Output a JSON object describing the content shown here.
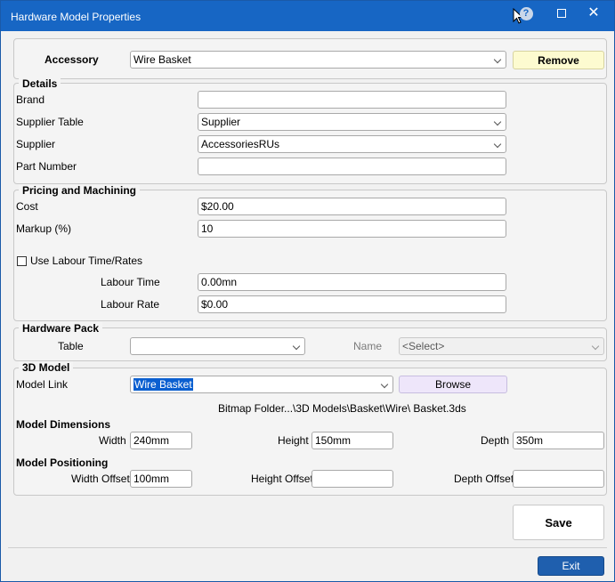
{
  "window": {
    "title": "Hardware Model Properties"
  },
  "accessory": {
    "label": "Accessory",
    "value": "Wire Basket",
    "remove_label": "Remove"
  },
  "details": {
    "title": "Details",
    "brand_label": "Brand",
    "brand_value": "",
    "supplier_table_label": "Supplier Table",
    "supplier_table_value": "Supplier",
    "supplier_label": "Supplier",
    "supplier_value": "AccessoriesRUs",
    "part_number_label": "Part Number",
    "part_number_value": ""
  },
  "pricing": {
    "title": "Pricing and Machining",
    "cost_label": "Cost",
    "cost_value": "$20.00",
    "markup_label": "Markup (%)",
    "markup_value": "10",
    "labour_checkbox_label": "Use Labour Time/Rates",
    "labour_time_label": "Labour Time",
    "labour_time_value": "0.00mn",
    "labour_rate_label": "Labour Rate",
    "labour_rate_value": "$0.00"
  },
  "hardware_pack": {
    "title": "Hardware Pack",
    "table_label": "Table",
    "table_value": "",
    "name_label": "Name",
    "name_value": "<Select>"
  },
  "model3d": {
    "title": "3D Model",
    "link_label": "Model Link",
    "link_value": "Wire Basket",
    "browse_label": "Browse",
    "path": "Bitmap Folder...\\3D Models\\Basket\\Wire\\  Basket.3ds",
    "dimensions_title": "Model Dimensions",
    "width_label": "Width",
    "width_value": "240mm",
    "height_label": "Height",
    "height_value": "150mm",
    "depth_label": "Depth",
    "depth_value": "350m",
    "positioning_title": "Model Positioning",
    "width_offset_label": "Width Offset",
    "width_offset_value": "100mm",
    "height_offset_label": "Height Offset",
    "height_offset_value": "",
    "depth_offset_label": "Depth Offset",
    "depth_offset_value": ""
  },
  "actions": {
    "save_label": "Save",
    "exit_label": "Exit"
  },
  "colors": {
    "titlebar": "#1766c4",
    "remove_button": "#fdfbd0",
    "browse_button": "#eee6fa",
    "exit_button": "#1f5fae"
  }
}
